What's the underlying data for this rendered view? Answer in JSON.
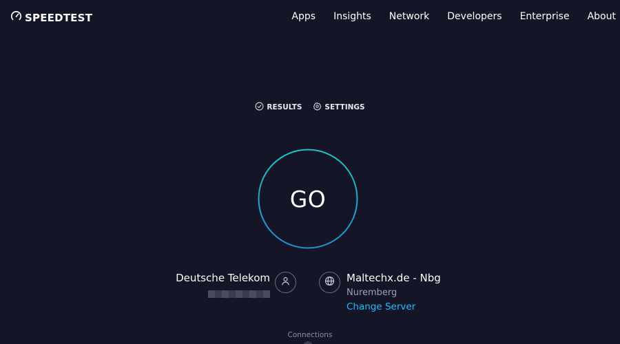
{
  "brand": {
    "name": "SPEEDTEST",
    "icon": "speedometer-icon"
  },
  "nav": {
    "items": [
      {
        "label": "Apps"
      },
      {
        "label": "Insights"
      },
      {
        "label": "Network"
      },
      {
        "label": "Developers"
      },
      {
        "label": "Enterprise"
      },
      {
        "label": "About"
      }
    ]
  },
  "util": {
    "results_label": "RESULTS",
    "results_icon": "check-circle-icon",
    "settings_label": "SETTINGS",
    "settings_icon": "gear-icon"
  },
  "go": {
    "label": "GO"
  },
  "isp": {
    "name": "Deutsche Telekom",
    "icon": "user-icon"
  },
  "server": {
    "name": "Maltechx.de - Nbg",
    "location": "Nuremberg",
    "change_label": "Change Server",
    "icon": "globe-icon"
  },
  "connections": {
    "label": "Connections"
  },
  "colors": {
    "background": "#141526",
    "ring_start": "#1ec8c8",
    "ring_end": "#1f8fd8",
    "link": "#1cbfff"
  }
}
